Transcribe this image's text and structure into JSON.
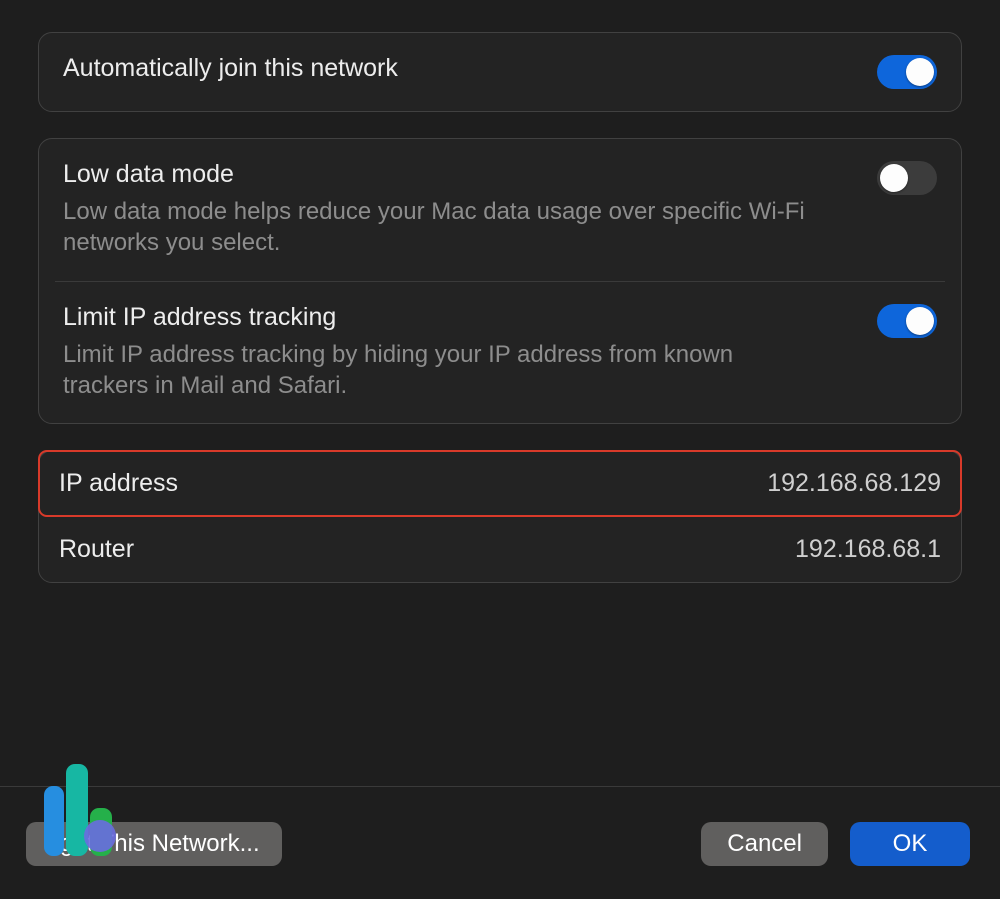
{
  "settings": {
    "autoJoin": {
      "label": "Automatically join this network",
      "on": true
    },
    "lowData": {
      "label": "Low data mode",
      "description": "Low data mode helps reduce your Mac data usage over specific Wi-Fi networks you select.",
      "on": false
    },
    "limitTracking": {
      "label": "Limit IP address tracking",
      "description": "Limit IP address tracking by hiding your IP address from known trackers in Mail and Safari.",
      "on": true
    }
  },
  "network": {
    "ipAddress": {
      "label": "IP address",
      "value": "192.168.68.129"
    },
    "router": {
      "label": "Router",
      "value": "192.168.68.1"
    }
  },
  "footer": {
    "forget": "get This Network...",
    "cancel": "Cancel",
    "ok": "OK"
  }
}
